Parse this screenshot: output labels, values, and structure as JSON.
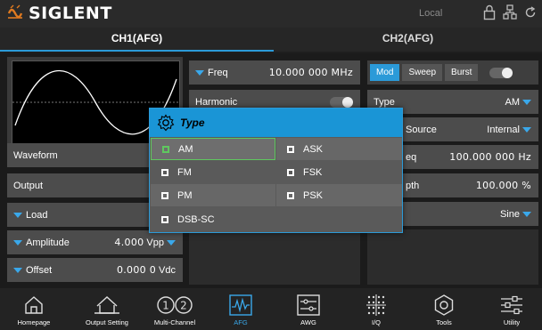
{
  "brand": "SIGLENT",
  "status": {
    "mode": "Local"
  },
  "tabs": [
    {
      "label": "CH1(AFG)"
    },
    {
      "label": "CH2(AFG)"
    }
  ],
  "ch1": {
    "freq": {
      "label": "Freq",
      "value": "10.000 000 MHz"
    },
    "harmonic": {
      "label": "Harmonic"
    },
    "waveform": {
      "label": "Waveform",
      "value": "S"
    },
    "output": {
      "label": "Output"
    },
    "load": {
      "label": "Load"
    },
    "amplitude": {
      "label": "Amplitude",
      "value": "4.000",
      "unit": "Vpp"
    },
    "offset": {
      "label": "Offset",
      "value": "0.000 0",
      "unit": "Vdc"
    }
  },
  "ch2": {
    "mode_buttons": [
      "Mod",
      "Sweep",
      "Burst"
    ],
    "type": {
      "label": "Type",
      "value": "AM"
    },
    "source": {
      "label": "Source",
      "value": "Internal"
    },
    "freq": {
      "label": "eq",
      "value": "100.000 000 Hz"
    },
    "depth": {
      "label": "pth",
      "value": "100.000 %"
    },
    "shape": {
      "value": "Sine"
    }
  },
  "popup": {
    "title": "Type",
    "options": [
      {
        "label": "AM",
        "selected": true
      },
      {
        "label": "ASK"
      },
      {
        "label": "FM"
      },
      {
        "label": "FSK"
      },
      {
        "label": "PM"
      },
      {
        "label": "PSK"
      },
      {
        "label": "DSB-SC"
      }
    ]
  },
  "bottom": [
    {
      "label": "Homepage",
      "icon": "home-icon"
    },
    {
      "label": "Output Setting",
      "icon": "output-setting-icon"
    },
    {
      "label": "Multi-Channel",
      "icon": "multi-channel-icon"
    },
    {
      "label": "AFG",
      "icon": "afg-icon",
      "active": true
    },
    {
      "label": "AWG",
      "icon": "awg-icon"
    },
    {
      "label": "I/Q",
      "icon": "iq-icon"
    },
    {
      "label": "Tools",
      "icon": "tools-icon"
    },
    {
      "label": "Utility",
      "icon": "utility-icon"
    }
  ],
  "colors": {
    "accent": "#2b9ad8",
    "selected": "#5fc85f",
    "logo": "#e07a20"
  }
}
